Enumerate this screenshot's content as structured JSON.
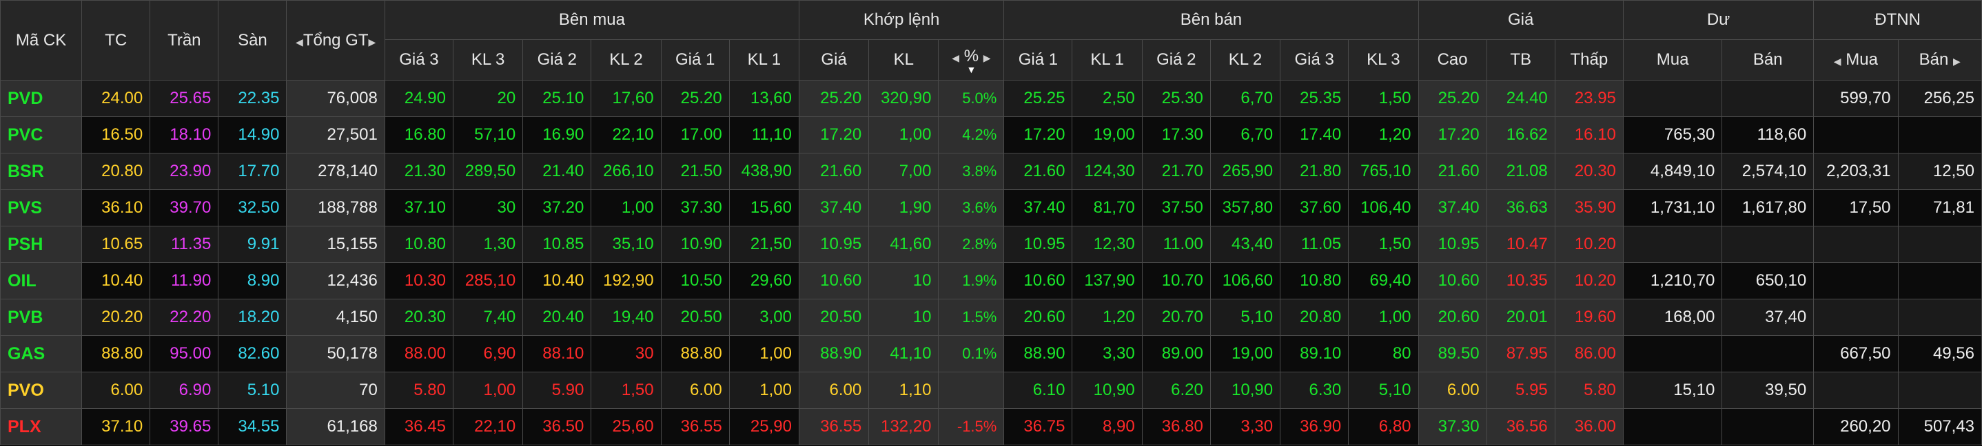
{
  "header": {
    "symbol": "Mã CK",
    "ref": "TC",
    "ceiling": "Trần",
    "floor": "Sàn",
    "total_value": "Tổng GT",
    "buy_side": "Bên mua",
    "matched": "Khớp lệnh",
    "sell_side": "Bên bán",
    "price": "Giá",
    "remaining": "Dư",
    "foreign": "ĐTNN",
    "buy_cols": [
      "Giá 3",
      "KL 3",
      "Giá 2",
      "KL 2",
      "Giá 1",
      "KL 1"
    ],
    "match_cols": [
      "Giá",
      "KL",
      "%"
    ],
    "sell_cols": [
      "Giá 1",
      "KL 1",
      "Giá 2",
      "KL 2",
      "Giá 3",
      "KL 3"
    ],
    "price_cols": [
      "Cao",
      "TB",
      "Thấp"
    ],
    "remaining_cols": [
      "Mua",
      "Bán"
    ],
    "foreign_cols": [
      "Mua",
      "Bán"
    ]
  },
  "colors": {
    "up": "#19e62a",
    "down": "#ff2929",
    "ref": "#ffd12a",
    "ceiling": "#e63cf5",
    "floor": "#36d8ee",
    "neutral": "#eeeeee"
  },
  "rows": [
    [
      "PVD",
      "24.00",
      "25.65",
      "22.35",
      "76,008",
      "24.90",
      "20",
      "25.10",
      "17,60",
      "25.20",
      "13,60",
      "25.20",
      "320,90",
      "5.0%",
      "25.25",
      "2,50",
      "25.30",
      "6,70",
      "25.35",
      "1,50",
      "25.20",
      "24.40",
      "23.95",
      "",
      "",
      "599,70",
      "256,25"
    ],
    [
      "PVC",
      "16.50",
      "18.10",
      "14.90",
      "27,501",
      "16.80",
      "57,10",
      "16.90",
      "22,10",
      "17.00",
      "11,10",
      "17.20",
      "1,00",
      "4.2%",
      "17.20",
      "19,00",
      "17.30",
      "6,70",
      "17.40",
      "1,20",
      "17.20",
      "16.62",
      "16.10",
      "765,30",
      "118,60",
      "",
      ""
    ],
    [
      "BSR",
      "20.80",
      "23.90",
      "17.70",
      "278,140",
      "21.30",
      "289,50",
      "21.40",
      "266,10",
      "21.50",
      "438,90",
      "21.60",
      "7,00",
      "3.8%",
      "21.60",
      "124,30",
      "21.70",
      "265,90",
      "21.80",
      "765,10",
      "21.60",
      "21.08",
      "20.30",
      "4,849,10",
      "2,574,10",
      "2,203,31",
      "12,50"
    ],
    [
      "PVS",
      "36.10",
      "39.70",
      "32.50",
      "188,788",
      "37.10",
      "30",
      "37.20",
      "1,00",
      "37.30",
      "15,60",
      "37.40",
      "1,90",
      "3.6%",
      "37.40",
      "81,70",
      "37.50",
      "357,80",
      "37.60",
      "106,40",
      "37.40",
      "36.63",
      "35.90",
      "1,731,10",
      "1,617,80",
      "17,50",
      "71,81"
    ],
    [
      "PSH",
      "10.65",
      "11.35",
      "9.91",
      "15,155",
      "10.80",
      "1,30",
      "10.85",
      "35,10",
      "10.90",
      "21,50",
      "10.95",
      "41,60",
      "2.8%",
      "10.95",
      "12,30",
      "11.00",
      "43,40",
      "11.05",
      "1,50",
      "10.95",
      "10.47",
      "10.20",
      "",
      "",
      "",
      ""
    ],
    [
      "OIL",
      "10.40",
      "11.90",
      "8.90",
      "12,436",
      "10.30",
      "285,10",
      "10.40",
      "192,90",
      "10.50",
      "29,60",
      "10.60",
      "10",
      "1.9%",
      "10.60",
      "137,90",
      "10.70",
      "106,60",
      "10.80",
      "69,40",
      "10.60",
      "10.35",
      "10.20",
      "1,210,70",
      "650,10",
      "",
      ""
    ],
    [
      "PVB",
      "20.20",
      "22.20",
      "18.20",
      "4,150",
      "20.30",
      "7,40",
      "20.40",
      "19,40",
      "20.50",
      "3,00",
      "20.50",
      "10",
      "1.5%",
      "20.60",
      "1,20",
      "20.70",
      "5,10",
      "20.80",
      "1,00",
      "20.60",
      "20.01",
      "19.60",
      "168,00",
      "37,40",
      "",
      ""
    ],
    [
      "GAS",
      "88.80",
      "95.00",
      "82.60",
      "50,178",
      "88.00",
      "6,90",
      "88.10",
      "30",
      "88.80",
      "1,00",
      "88.90",
      "41,10",
      "0.1%",
      "88.90",
      "3,30",
      "89.00",
      "19,00",
      "89.10",
      "80",
      "89.50",
      "87.95",
      "86.00",
      "",
      "",
      "667,50",
      "49,56"
    ],
    [
      "PVO",
      "6.00",
      "6.90",
      "5.10",
      "70",
      "5.80",
      "1,00",
      "5.90",
      "1,50",
      "6.00",
      "1,00",
      "6.00",
      "1,10",
      "",
      "6.10",
      "10,90",
      "6.20",
      "10,90",
      "6.30",
      "5,10",
      "6.00",
      "5.95",
      "5.80",
      "15,10",
      "39,50",
      "",
      ""
    ],
    [
      "PLX",
      "37.10",
      "39.65",
      "34.55",
      "61,168",
      "36.45",
      "22,10",
      "36.50",
      "25,60",
      "36.55",
      "25,90",
      "36.55",
      "132,20",
      "-1.5%",
      "36.75",
      "8,90",
      "36.80",
      "3,30",
      "36.90",
      "6,80",
      "37.30",
      "36.56",
      "36.00",
      "",
      "",
      "260,20",
      "507,43"
    ]
  ],
  "row_colors": [
    [
      "g",
      "y",
      "f",
      "c",
      "w",
      "g",
      "g",
      "g",
      "g",
      "g",
      "g",
      "g",
      "g",
      "g",
      "g",
      "g",
      "g",
      "g",
      "g",
      "g",
      "g",
      "g",
      "r",
      "w",
      "w",
      "w",
      "w"
    ],
    [
      "g",
      "y",
      "f",
      "c",
      "w",
      "g",
      "g",
      "g",
      "g",
      "g",
      "g",
      "g",
      "g",
      "g",
      "g",
      "g",
      "g",
      "g",
      "g",
      "g",
      "g",
      "g",
      "r",
      "w",
      "w",
      "w",
      "w"
    ],
    [
      "g",
      "y",
      "f",
      "c",
      "w",
      "g",
      "g",
      "g",
      "g",
      "g",
      "g",
      "g",
      "g",
      "g",
      "g",
      "g",
      "g",
      "g",
      "g",
      "g",
      "g",
      "g",
      "r",
      "w",
      "w",
      "w",
      "w"
    ],
    [
      "g",
      "y",
      "f",
      "c",
      "w",
      "g",
      "g",
      "g",
      "g",
      "g",
      "g",
      "g",
      "g",
      "g",
      "g",
      "g",
      "g",
      "g",
      "g",
      "g",
      "g",
      "g",
      "r",
      "w",
      "w",
      "w",
      "w"
    ],
    [
      "g",
      "y",
      "f",
      "c",
      "w",
      "g",
      "g",
      "g",
      "g",
      "g",
      "g",
      "g",
      "g",
      "g",
      "g",
      "g",
      "g",
      "g",
      "g",
      "g",
      "g",
      "r",
      "r",
      "w",
      "w",
      "w",
      "w"
    ],
    [
      "g",
      "y",
      "f",
      "c",
      "w",
      "r",
      "r",
      "y",
      "y",
      "g",
      "g",
      "g",
      "g",
      "g",
      "g",
      "g",
      "g",
      "g",
      "g",
      "g",
      "g",
      "r",
      "r",
      "w",
      "w",
      "w",
      "w"
    ],
    [
      "g",
      "y",
      "f",
      "c",
      "w",
      "g",
      "g",
      "g",
      "g",
      "g",
      "g",
      "g",
      "g",
      "g",
      "g",
      "g",
      "g",
      "g",
      "g",
      "g",
      "g",
      "g",
      "r",
      "w",
      "w",
      "w",
      "w"
    ],
    [
      "g",
      "y",
      "f",
      "c",
      "w",
      "r",
      "r",
      "r",
      "r",
      "y",
      "y",
      "g",
      "g",
      "g",
      "g",
      "g",
      "g",
      "g",
      "g",
      "g",
      "g",
      "r",
      "r",
      "w",
      "w",
      "w",
      "w"
    ],
    [
      "y",
      "y",
      "f",
      "c",
      "w",
      "r",
      "r",
      "r",
      "r",
      "y",
      "y",
      "y",
      "y",
      "y",
      "g",
      "g",
      "g",
      "g",
      "g",
      "g",
      "y",
      "r",
      "r",
      "w",
      "w",
      "w",
      "w"
    ],
    [
      "r",
      "y",
      "f",
      "c",
      "w",
      "r",
      "r",
      "r",
      "r",
      "r",
      "r",
      "r",
      "r",
      "r",
      "r",
      "r",
      "r",
      "r",
      "r",
      "r",
      "g",
      "r",
      "r",
      "w",
      "w",
      "w",
      "w"
    ]
  ]
}
